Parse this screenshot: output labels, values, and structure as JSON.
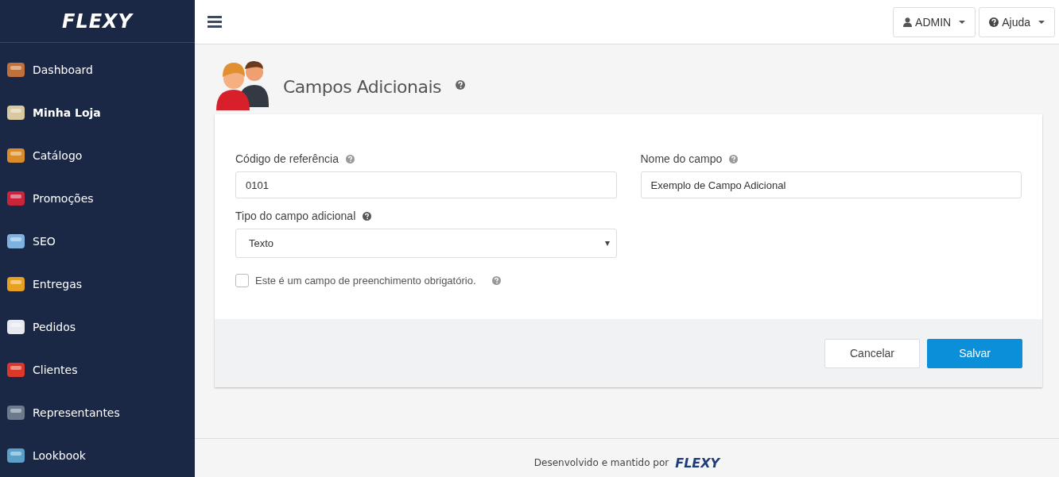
{
  "sidebar": {
    "logo": "FLEXY",
    "items": [
      {
        "label": "Dashboard",
        "selected": false
      },
      {
        "label": "Minha Loja",
        "selected": true
      },
      {
        "label": "Catálogo",
        "selected": false
      },
      {
        "label": "Promoções",
        "selected": false
      },
      {
        "label": "SEO",
        "selected": false
      },
      {
        "label": "Entregas",
        "selected": false
      },
      {
        "label": "Pedidos",
        "selected": false
      },
      {
        "label": "Clientes",
        "selected": false
      },
      {
        "label": "Representantes",
        "selected": false
      },
      {
        "label": "Lookbook",
        "selected": false
      }
    ]
  },
  "topbar": {
    "user_button": "ADMIN",
    "help_button": "Ajuda"
  },
  "page": {
    "title": "Campos Adicionais"
  },
  "form": {
    "reference_code": {
      "label": "Código de referência",
      "value": "0101"
    },
    "field_name": {
      "label": "Nome do campo",
      "value": "Exemplo de Campo Adicional"
    },
    "field_type": {
      "label": "Tipo do campo adicional",
      "value": "Texto"
    },
    "required": {
      "label": "Este é um campo de preenchimento obrigatório.",
      "checked": false
    },
    "buttons": {
      "cancel": "Cancelar",
      "save": "Salvar"
    }
  },
  "footer": {
    "text": "Desenvolvido e mantido por",
    "logo": "FLEXY"
  }
}
